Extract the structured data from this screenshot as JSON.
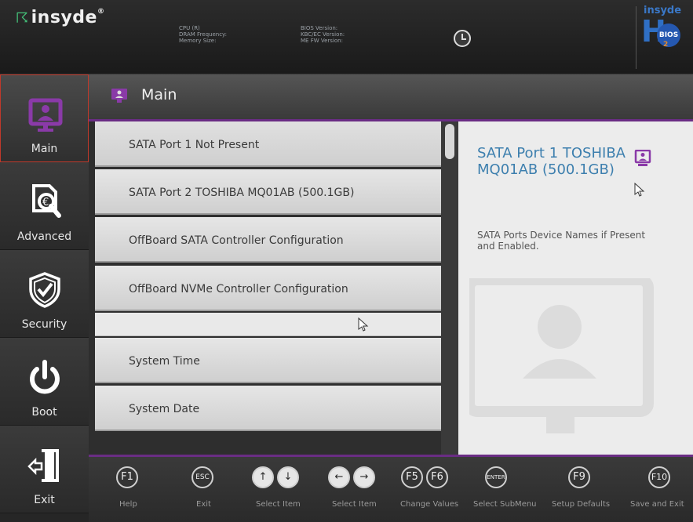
{
  "header": {
    "brand": "insyde",
    "brand_mark": "®",
    "info_left": [
      "CPU (R)",
      "DRAM Frequency:",
      "Memory Size:"
    ],
    "info_right": [
      "BIOS Version:",
      "KBC/EC Version:",
      "ME FW Version:"
    ],
    "logo_top": "insyde",
    "logo_h": "H",
    "logo_sub": "2",
    "logo_badge": "BIOS"
  },
  "sidebar": {
    "items": [
      {
        "label": "Main",
        "icon": "monitor-user-icon",
        "active": true
      },
      {
        "label": "Advanced",
        "icon": "document-magnify-icon",
        "active": false
      },
      {
        "label": "Security",
        "icon": "shield-check-icon",
        "active": false
      },
      {
        "label": "Boot",
        "icon": "power-icon",
        "active": false
      },
      {
        "label": "Exit",
        "icon": "exit-door-icon",
        "active": false
      }
    ]
  },
  "title": {
    "text": "Main",
    "icon": "monitor-user-icon"
  },
  "menu": {
    "items": [
      "SATA Port 1  Not Present",
      "SATA Port 2  TOSHIBA MQ01AB (500.1GB)",
      "OffBoard SATA Controller Configuration",
      "OffBoard NVMe Controller Configuration",
      "",
      "System Time",
      "System Date"
    ]
  },
  "help": {
    "title": "SATA Port 1 TOSHIBA MQ01AB (500.1GB)",
    "description": "SATA Ports Device Names if Present and Enabled."
  },
  "keys": [
    {
      "keys": [
        "F1"
      ],
      "label": "Help"
    },
    {
      "keys": [
        "ESC"
      ],
      "label": "Exit"
    },
    {
      "keys": [
        "↑",
        "↓"
      ],
      "label": "Select Item"
    },
    {
      "keys": [
        "←",
        "→"
      ],
      "label": "Select Item"
    },
    {
      "keys": [
        "F5",
        "F6"
      ],
      "label": "Change Values"
    },
    {
      "keys": [
        "ENTER"
      ],
      "label": "Select  SubMenu"
    },
    {
      "keys": [
        "F9"
      ],
      "label": "Setup Defaults"
    },
    {
      "keys": [
        "F10"
      ],
      "label": "Save and Exit"
    }
  ],
  "colors": {
    "accent_purple": "#7b3f99",
    "active_border": "#c0392b",
    "help_title": "#3d7fae"
  }
}
